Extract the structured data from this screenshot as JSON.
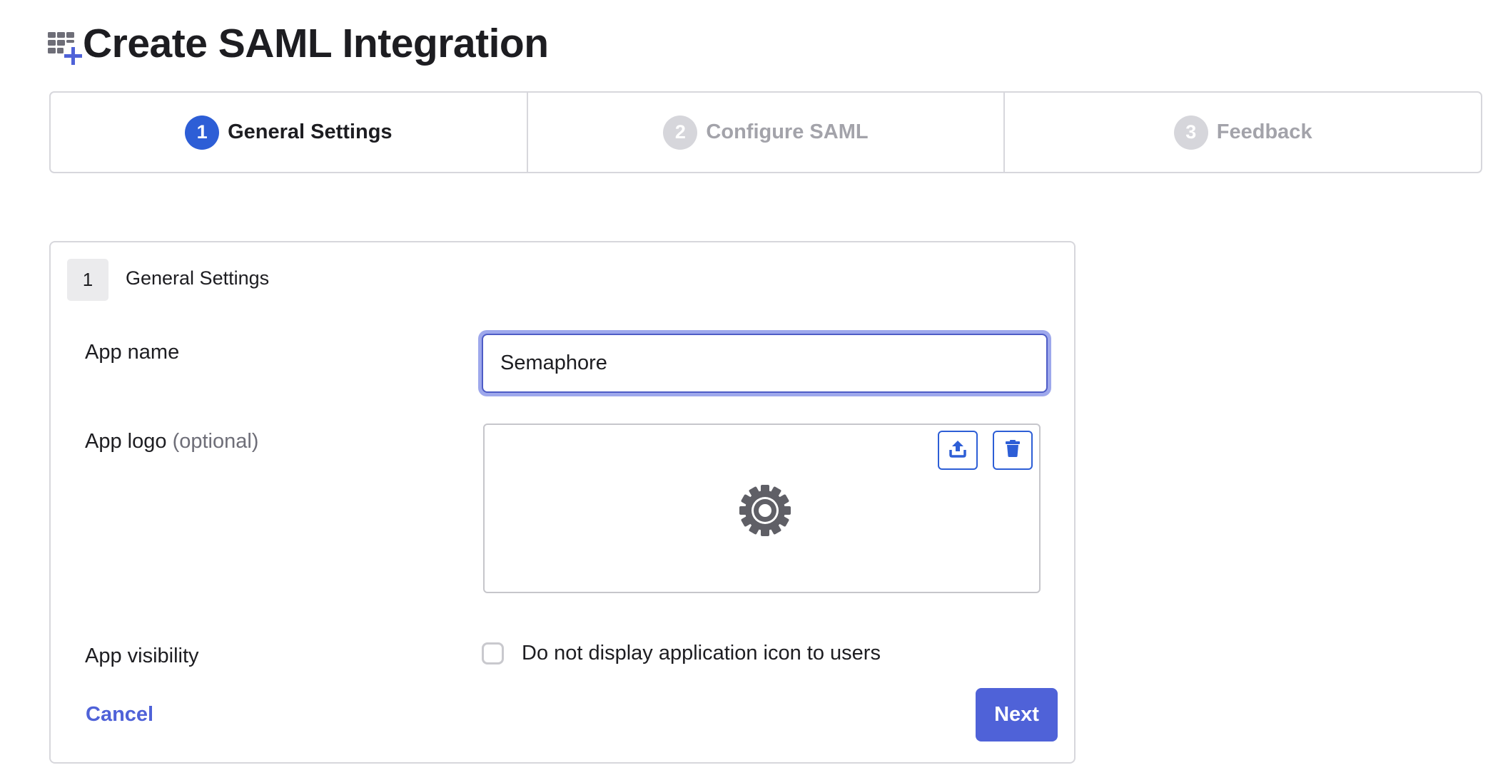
{
  "page": {
    "title": "Create SAML Integration",
    "title_icon": "app-grid-add-icon"
  },
  "stepper": {
    "steps": [
      {
        "number": "1",
        "label": "General Settings",
        "state": "active"
      },
      {
        "number": "2",
        "label": "Configure SAML",
        "state": "inactive"
      },
      {
        "number": "3",
        "label": "Feedback",
        "state": "inactive"
      }
    ]
  },
  "section": {
    "number": "1",
    "title": "General Settings"
  },
  "form": {
    "app_name": {
      "label": "App name",
      "value": "Semaphore"
    },
    "app_logo": {
      "label": "App logo",
      "optional": "(optional)",
      "upload_icon": "upload-icon",
      "delete_icon": "trash-icon",
      "placeholder_icon": "gear-icon"
    },
    "app_visibility": {
      "label": "App visibility",
      "checkbox_label": "Do not display application icon to users",
      "checked": false
    }
  },
  "actions": {
    "cancel_label": "Cancel",
    "next_label": "Next"
  },
  "colors": {
    "primary": "#4f62d8",
    "step_active": "#2d5ed6",
    "step_inactive": "#d6d6db",
    "focus_ring": "#9ea8ec"
  }
}
